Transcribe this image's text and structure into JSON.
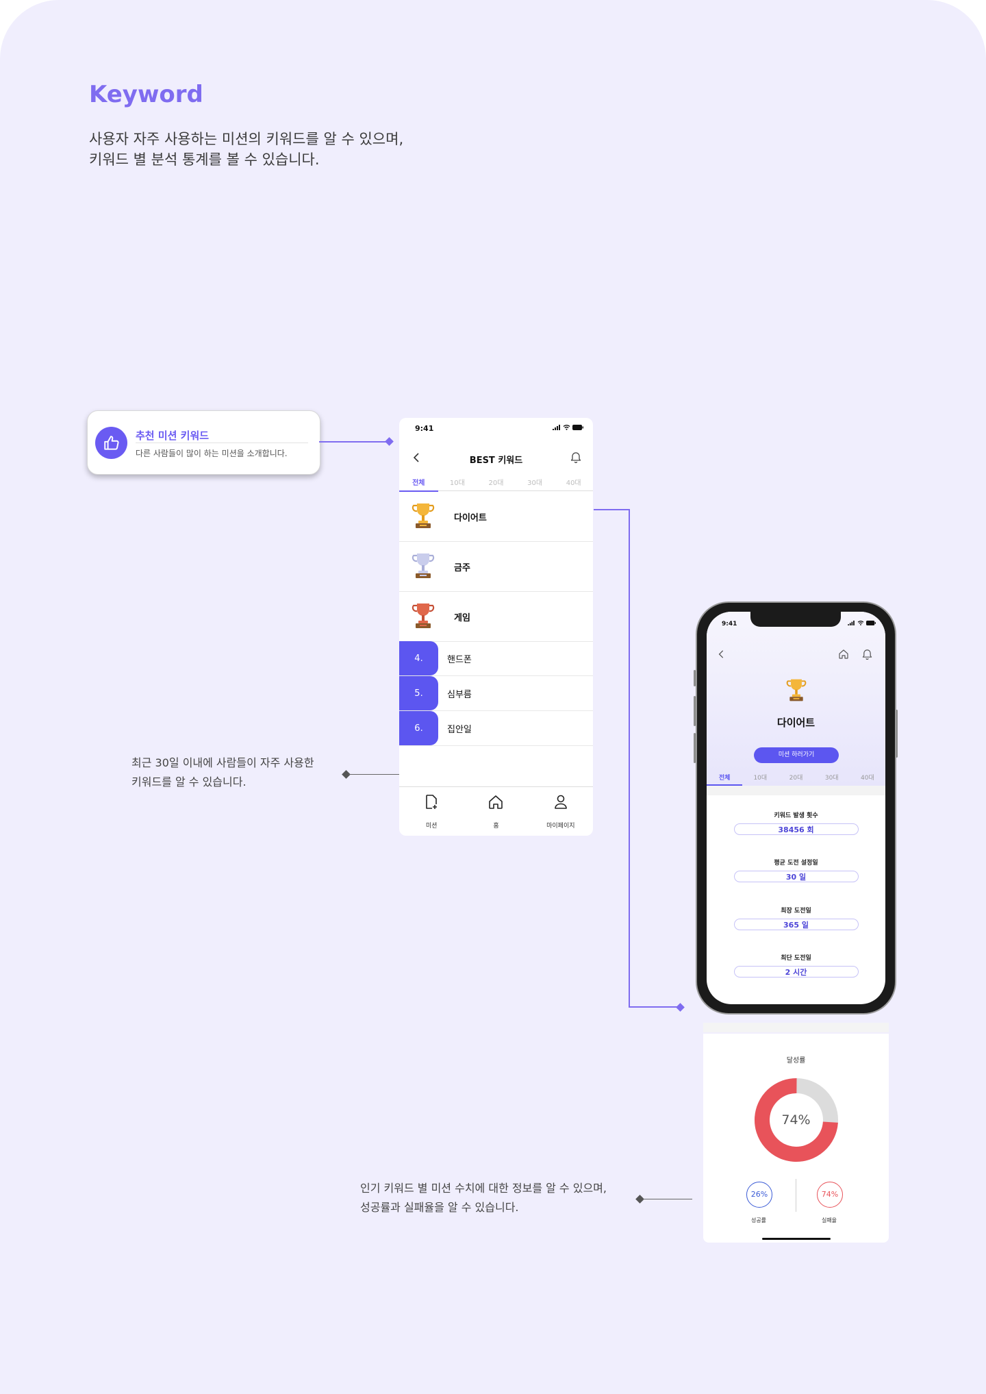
{
  "page": {
    "title": "Keyword",
    "subtitle_lines": [
      "사용자 자주 사용하는 미션의 키워드를 알 수 있으며,",
      "키워드 별 분석 통계를 볼 수 있습니다."
    ]
  },
  "callout": {
    "title": "추천 미션 키워드",
    "desc": "다른 사람들이 많이 하는 미션을 소개합니다."
  },
  "notes": {
    "recent": [
      "최근 30일 이내에 사람들이 자주 사용한",
      "키워드를 알 수 있습니다."
    ],
    "detail": [
      "인기 키워드 별 미션 수치에 대한 정보를 알 수 있으며,",
      "성공률과 실패율을 알 수 있습니다."
    ]
  },
  "best_screen": {
    "time": "9:41",
    "header_title": "BEST 키워드",
    "tabs": [
      "전체",
      "10대",
      "20대",
      "30대",
      "40대"
    ],
    "top3": [
      {
        "label": "다이어트",
        "trophy": "gold-trophy-icon"
      },
      {
        "label": "금주",
        "trophy": "silver-trophy-icon"
      },
      {
        "label": "게임",
        "trophy": "bronze-trophy-icon"
      }
    ],
    "ranks": [
      {
        "num": "4.",
        "label": "핸드폰"
      },
      {
        "num": "5.",
        "label": "심부름"
      },
      {
        "num": "6.",
        "label": "집안일"
      }
    ],
    "nav": [
      {
        "label": "미션",
        "icon": "add-document-icon"
      },
      {
        "label": "홈",
        "icon": "home-icon"
      },
      {
        "label": "마이페이지",
        "icon": "user-icon"
      }
    ]
  },
  "detail_screen": {
    "time": "9:41",
    "keyword": "다이어트",
    "cta": "미션 하러가기",
    "tabs": [
      "전체",
      "10대",
      "20대",
      "30대",
      "40대"
    ],
    "stats": [
      {
        "label": "키워드 발생 횟수",
        "value": "38456 회"
      },
      {
        "label": "평균 도전 설정일",
        "value": "30 일"
      },
      {
        "label": "최장 도전일",
        "value": "365 일"
      },
      {
        "label": "최단 도전일",
        "value": "2 시간"
      }
    ],
    "achievement": {
      "title": "달성률",
      "percent_label": "74%",
      "percent": 74,
      "success_label": "성공률",
      "success_value": "26%",
      "fail_label": "실패율",
      "fail_value": "74%"
    }
  },
  "colors": {
    "accent": "#6a5bf2",
    "connector": "#7f6cf0",
    "fail_red": "#e8535a",
    "success_blue": "#3b5bd6"
  }
}
